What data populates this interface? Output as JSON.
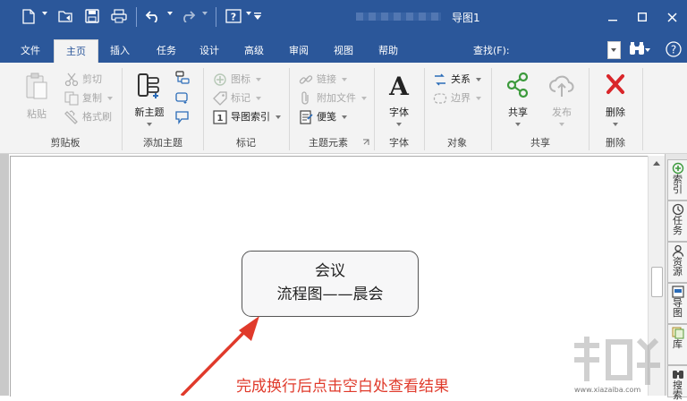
{
  "window": {
    "title": "导图1"
  },
  "tabs": [
    "文件",
    "主页",
    "插入",
    "任务",
    "设计",
    "高级",
    "审阅",
    "视图",
    "帮助"
  ],
  "active_tab": "主页",
  "find_label": "查找(F):",
  "ribbon": {
    "clipboard": {
      "paste": "粘贴",
      "cut": "剪切",
      "copy": "复制",
      "format_painter": "格式刷",
      "group_label": "剪贴板"
    },
    "add_topic": {
      "new_topic": "新主题",
      "group_label": "添加主题"
    },
    "markers": {
      "icon": "图标",
      "tag": "标记",
      "map_index": "导图索引",
      "group_label": "标记"
    },
    "topic_elements": {
      "link": "链接",
      "attachment": "附加文件",
      "note": "便笺",
      "group_label": "主题元素"
    },
    "font": {
      "font": "字体",
      "group_label": "字体"
    },
    "objects": {
      "relationship": "关系",
      "boundary": "边界",
      "group_label": "对象"
    },
    "share": {
      "share": "共享",
      "publish": "发布",
      "group_label": "共享"
    },
    "delete": {
      "delete": "删除",
      "group_label": "删除"
    }
  },
  "side_panel": [
    "索引",
    "任务",
    "资源",
    "导图",
    "库",
    "搜索"
  ],
  "topic": {
    "line1": "会议",
    "line2": "流程图——晨会"
  },
  "annotation": "完成换行后点击空白处查看结果",
  "watermark": {
    "text": "www.xiazaiba.com"
  },
  "colors": {
    "title_bar": "#2b579a",
    "annotation_red": "#e03a2b",
    "delete_red": "#d9262a",
    "share_green": "#3c9a3c"
  }
}
